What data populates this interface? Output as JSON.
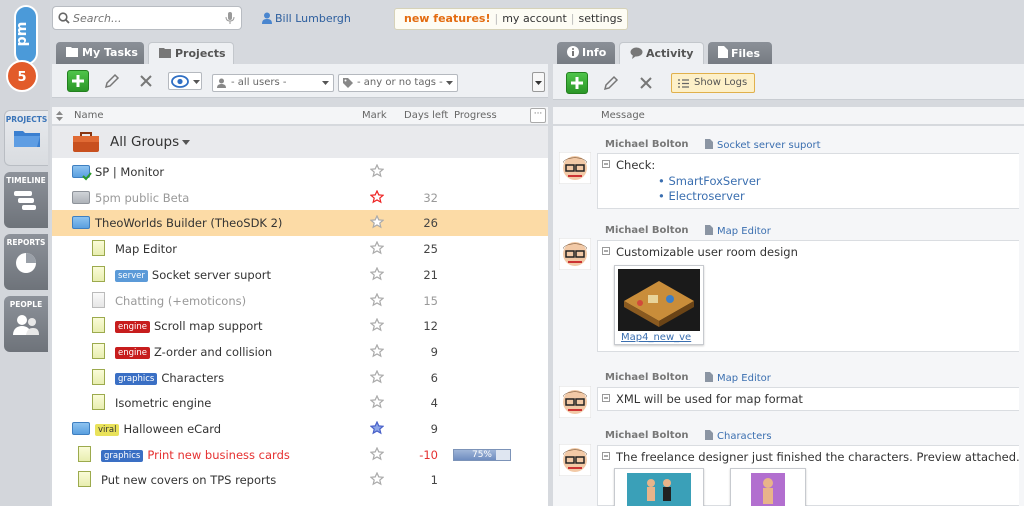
{
  "app": {
    "logo_text": "5pm"
  },
  "rail": {
    "items": [
      {
        "label": "PROJECTS"
      },
      {
        "label": "TIMELINE"
      },
      {
        "label": "REPORTS"
      },
      {
        "label": "PEOPLE"
      }
    ]
  },
  "search": {
    "placeholder": "Search..."
  },
  "user": {
    "name": "Bill Lumbergh"
  },
  "topmenu": {
    "new_features": "new features!",
    "my_account": "my account",
    "settings": "settings"
  },
  "left": {
    "tabs": [
      {
        "label": "My Tasks"
      },
      {
        "label": "Projects"
      }
    ],
    "filters": {
      "users": "- all users -",
      "tags": "- any or no tags -"
    },
    "columns": {
      "name": "Name",
      "mark": "Mark",
      "days": "Days left",
      "progress": "Progress"
    },
    "group": "All Groups",
    "rows": [
      {
        "name": "SP | Monitor",
        "tag": "",
        "days": "",
        "kind": "folder-done"
      },
      {
        "name": "5pm public Beta",
        "tag": "",
        "days": "32",
        "kind": "folder-grey",
        "starred": "red"
      },
      {
        "name": "TheoWorlds Builder (TheoSDK 2)",
        "tag": "",
        "days": "26",
        "kind": "folder-open"
      },
      {
        "name": "Map Editor",
        "tag": "",
        "days": "25",
        "kind": "doc"
      },
      {
        "name": "Socket server suport",
        "tag": "server",
        "days": "21",
        "kind": "doc"
      },
      {
        "name": "Chatting (+emoticons)",
        "tag": "",
        "days": "15",
        "kind": "doc-grey"
      },
      {
        "name": "Scroll map support",
        "tag": "engine",
        "days": "12",
        "kind": "doc"
      },
      {
        "name": "Z-order and collision",
        "tag": "engine",
        "days": "9",
        "kind": "doc"
      },
      {
        "name": "Characters",
        "tag": "graphics",
        "days": "6",
        "kind": "doc"
      },
      {
        "name": "Isometric engine",
        "tag": "",
        "days": "4",
        "kind": "doc"
      },
      {
        "name": "Halloween eCard",
        "tag": "viral",
        "days": "9",
        "kind": "folder",
        "starred": "blue"
      },
      {
        "name": "Print new business cards",
        "tag": "graphics",
        "days": "-10",
        "kind": "doc-top",
        "progress": 75,
        "progress_label": "75%"
      },
      {
        "name": "Put new covers on TPS reports",
        "tag": "",
        "days": "1",
        "kind": "doc-top"
      }
    ]
  },
  "right": {
    "tabs": [
      {
        "label": "Info"
      },
      {
        "label": "Activity"
      },
      {
        "label": "Files"
      }
    ],
    "show_logs": "Show Logs",
    "column": "Message",
    "entries": [
      {
        "author": "Michael Bolton",
        "task": "Socket server suport",
        "message": "Check:",
        "list": [
          "SmartFoxServer",
          "Electroserver"
        ]
      },
      {
        "author": "Michael Bolton",
        "task": "Map Editor",
        "message": "Customizable user room design",
        "attachment": "Map4_new_ve"
      },
      {
        "author": "Michael Bolton",
        "task": "Map Editor",
        "message": "XML will be used for map format"
      },
      {
        "author": "Michael Bolton",
        "task": "Characters",
        "message": "The freelance designer just finished the characters. Preview attached."
      }
    ]
  },
  "colors": {
    "tag_server": "#5b9ad8",
    "tag_engine": "#c71d1d",
    "tag_graphics": "#3a6fc4",
    "tag_viral": "#e9e25a",
    "selected_row": "#fcdba6",
    "overdue": "#e53131",
    "accent_green": "#2b9627"
  }
}
